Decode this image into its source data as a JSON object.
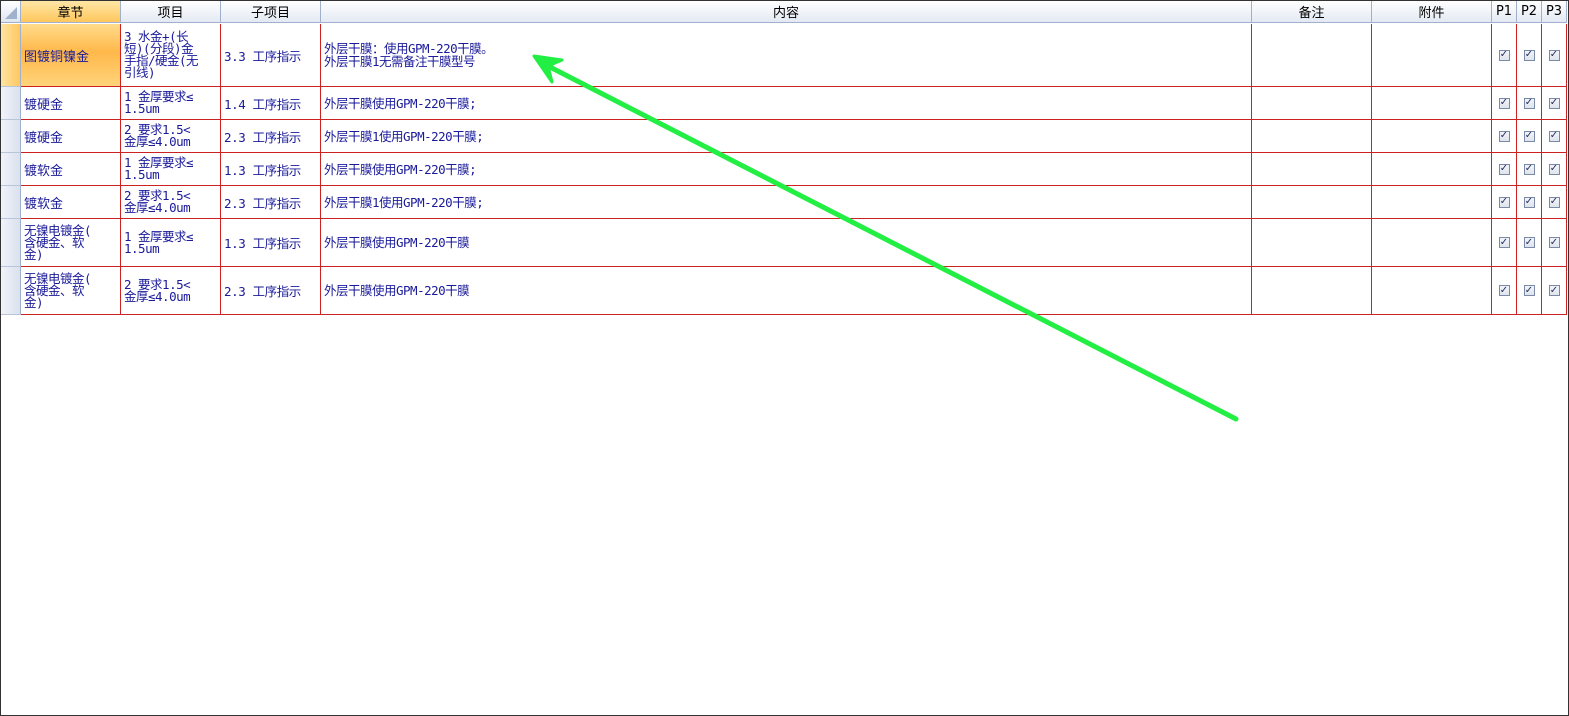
{
  "columns": [
    "章节",
    "项目",
    "子项目",
    "内容",
    "备注",
    "附件",
    "P1",
    "P2",
    "P3"
  ],
  "rows": [
    {
      "chapter": "图镀铜镍金",
      "item": "3 水金+(长\n短)(分段)金\n手指/硬金(无\n引线)",
      "sub": "3.3 工序指示",
      "content": "外层干膜：使用GPM-220干膜。\n外层干膜1无需备注干膜型号",
      "note": "",
      "attachment": "",
      "p1": true,
      "p2": true,
      "p3": true,
      "selected": true
    },
    {
      "chapter": "镀硬金",
      "item": "1 金厚要求≤\n1.5um",
      "sub": "1.4 工序指示",
      "content": "外层干膜使用GPM-220干膜;",
      "note": "",
      "attachment": "",
      "p1": true,
      "p2": true,
      "p3": true,
      "selected": false
    },
    {
      "chapter": "镀硬金",
      "item": "2 要求1.5<\n金厚≤4.0um",
      "sub": "2.3 工序指示",
      "content": "外层干膜1使用GPM-220干膜;",
      "note": "",
      "attachment": "",
      "p1": true,
      "p2": true,
      "p3": true,
      "selected": false
    },
    {
      "chapter": "镀软金",
      "item": "1 金厚要求≤\n1.5um",
      "sub": "1.3 工序指示",
      "content": "外层干膜使用GPM-220干膜;",
      "note": "",
      "attachment": "",
      "p1": true,
      "p2": true,
      "p3": true,
      "selected": false
    },
    {
      "chapter": "镀软金",
      "item": "2 要求1.5<\n金厚≤4.0um",
      "sub": "2.3 工序指示",
      "content": "外层干膜1使用GPM-220干膜;",
      "note": "",
      "attachment": "",
      "p1": true,
      "p2": true,
      "p3": true,
      "selected": false
    },
    {
      "chapter": "无镍电镀金(\n含硬金、软\n金)",
      "item": "1 金厚要求≤\n1.5um",
      "sub": "1.3 工序指示",
      "content": "外层干膜使用GPM-220干膜",
      "note": "",
      "attachment": "",
      "p1": true,
      "p2": true,
      "p3": true,
      "selected": false
    },
    {
      "chapter": "无镍电镀金(\n含硬金、软\n金)",
      "item": "2 要求1.5<\n金厚≤4.0um",
      "sub": "2.3 工序指示",
      "content": "外层干膜使用GPM-220干膜",
      "note": "",
      "attachment": "",
      "p1": true,
      "p2": true,
      "p3": true,
      "selected": false
    }
  ],
  "check_glyph": "✓",
  "colors": {
    "grid_line": "#cc2222",
    "text": "#1a1a9a",
    "selection": "#ffc75d",
    "annotation_arrow": "#22ee44"
  },
  "icons": {
    "checkbox": "checkbox-icon",
    "annotation": "green-arrow-annotation"
  }
}
